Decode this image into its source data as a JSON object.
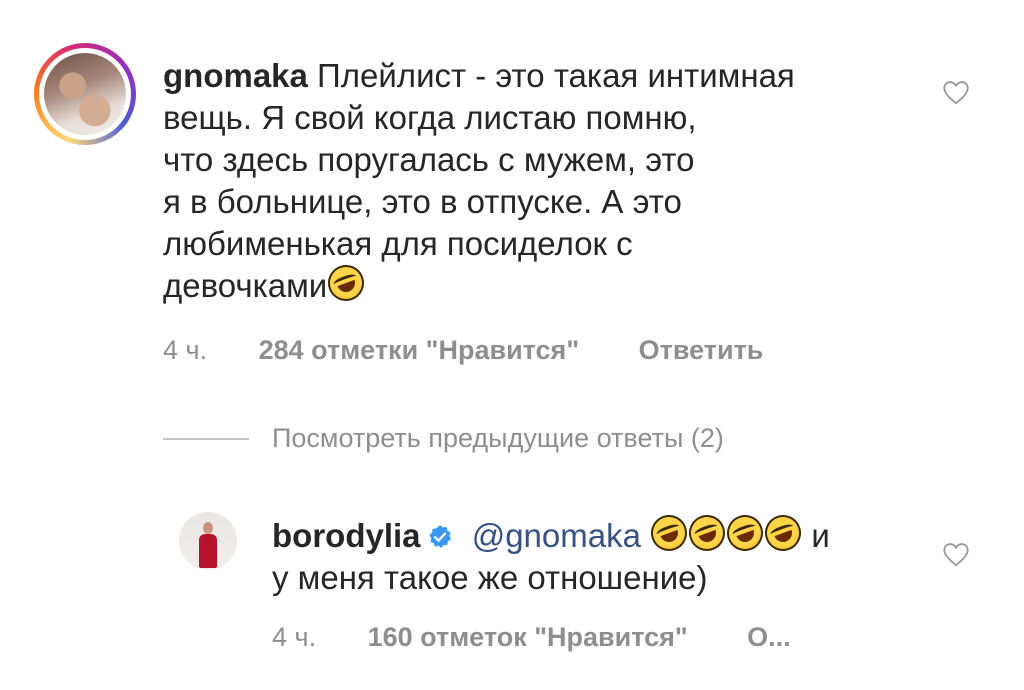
{
  "comment": {
    "username": "gnomaka",
    "lines": [
      "Плейлист - это такая интимная",
      "вещь. Я свой когда листаю помню,",
      "что здесь поругалась с мужем, это",
      "я в больнице, это в отпуске. А это",
      "любименькая для посиделок с",
      "девочками"
    ],
    "emoji": "face-with-tears-of-joy",
    "time": "4 ч.",
    "likes": "284 отметки \"Нравится\"",
    "reply_label": "Ответить"
  },
  "view_previous_replies": "Посмотреть предыдущие ответы (2)",
  "reply": {
    "username": "borodylia",
    "verified": true,
    "mention": "@gnomaka",
    "emojis": [
      "rolling-on-the-floor-laughing",
      "rolling-on-the-floor-laughing",
      "rolling-on-the-floor-laughing",
      "rolling-on-the-floor-laughing"
    ],
    "text_after": "и",
    "line2": "у меня такое же отношение)",
    "time": "4 ч.",
    "likes": "160 отметок \"Нравится\"",
    "reply_label": "О..."
  },
  "colors": {
    "text": "#262626",
    "secondary": "#8e8e8e",
    "mention": "#385185",
    "verified": "#3897f0"
  }
}
